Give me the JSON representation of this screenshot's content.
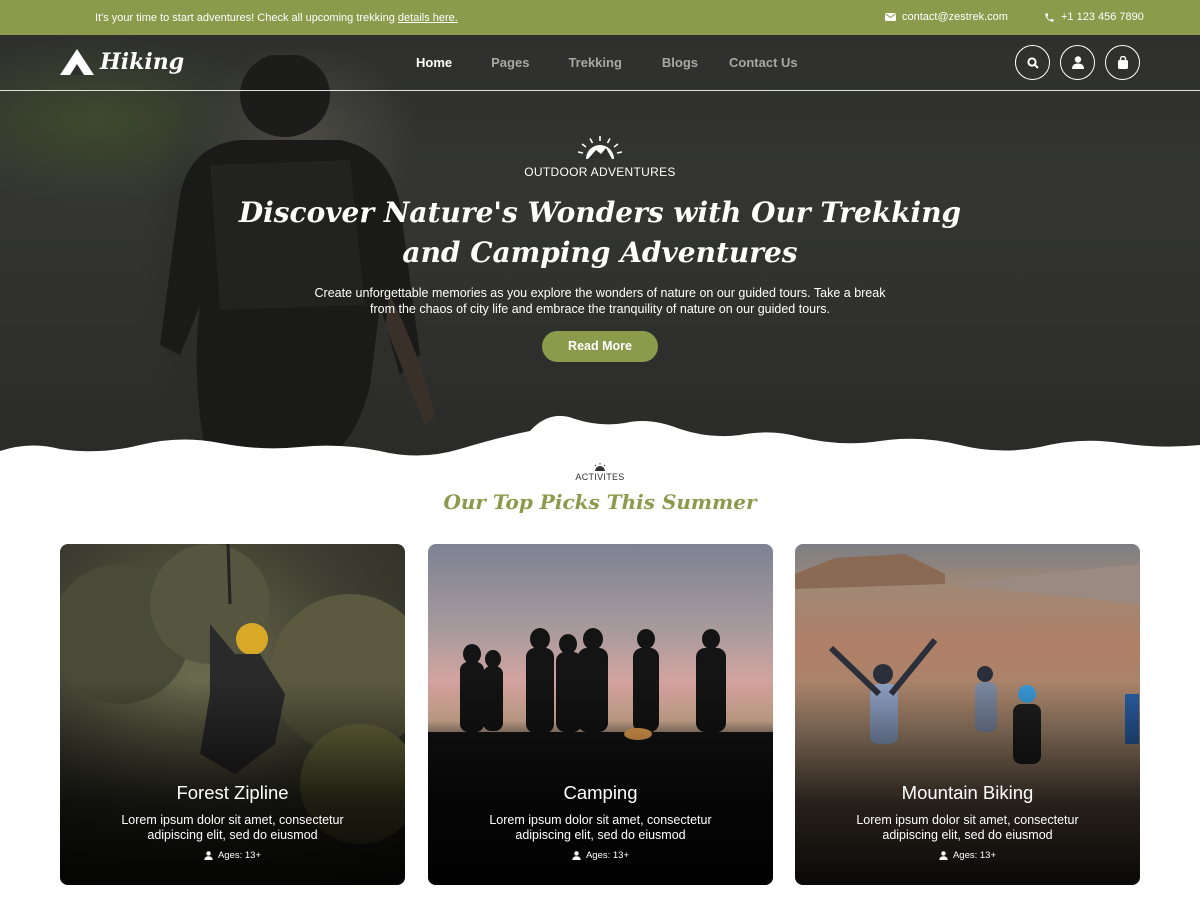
{
  "topbar": {
    "message": "It's your time to start adventures! Check all upcoming trekking",
    "message_link": "details here.",
    "email": "contact@zestrek.com",
    "phone": "+1 123 456 7890"
  },
  "header": {
    "logo_text": "Hiking",
    "nav": [
      "Home",
      "Pages",
      "Trekking",
      "Blogs",
      "Contact Us"
    ],
    "active_nav": "Home",
    "icons": [
      "search-icon",
      "user-icon",
      "bag-icon"
    ]
  },
  "hero": {
    "tagline": "OUTDOOR ADVENTURES",
    "headline_line1": "Discover Nature's Wonders with Our Trekking",
    "headline_line2": "and Camping Adventures",
    "sub_line1": "Create unforgettable memories as you explore the wonders of nature on our guided tours. Take a break",
    "sub_line2": "from the chaos of city life and embrace the tranquility of nature on our guided tours.",
    "button": "Read More"
  },
  "activities": {
    "label": "ACTIVITES",
    "title": "Our Top Picks This Summer",
    "cards": [
      {
        "title": "Forest Zipline",
        "desc_line1": "Lorem ipsum dolor sit amet, consectetur",
        "desc_line2": "adipiscing elit, sed do eiusmod",
        "ages": "Ages: 13+"
      },
      {
        "title": "Camping",
        "desc_line1": "Lorem ipsum dolor sit amet, consectetur",
        "desc_line2": "adipiscing elit, sed do eiusmod",
        "ages": "Ages: 13+"
      },
      {
        "title": "Mountain Biking",
        "desc_line1": "Lorem ipsum dolor sit amet, consectetur",
        "desc_line2": "adipiscing elit, sed do eiusmod",
        "ages": "Ages: 13+"
      }
    ]
  },
  "colors": {
    "accent": "#8b9a4b",
    "hero_bg": "#2f302d",
    "text_light": "#ffffff"
  }
}
